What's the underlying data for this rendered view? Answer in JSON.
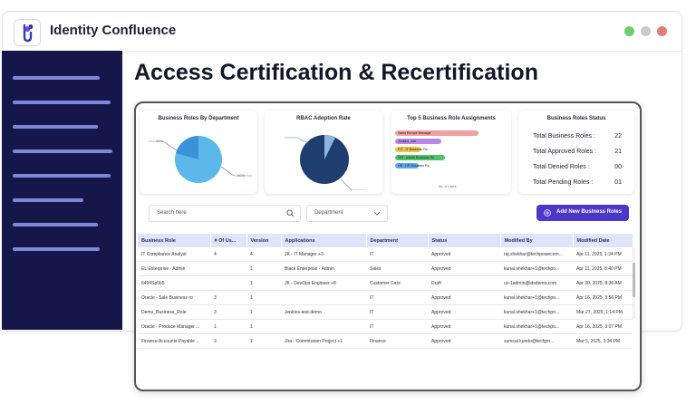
{
  "app": {
    "title": "Identity Confluence"
  },
  "page": {
    "title": "Access Certification & Recertification"
  },
  "colors": {
    "sidebar": "#15174a",
    "accent": "#4b37c9",
    "approved": "#2e9e45",
    "dot_green": "#6ccf6c",
    "dot_gray": "#c9c9cf",
    "dot_red": "#e27b7b"
  },
  "cards": {
    "roles_by_department": {
      "title": "Business Roles By Department",
      "label_left": "10%",
      "label_right": "90%"
    },
    "rbac_adoption": {
      "title": "RBAC Adoption Rate"
    },
    "top5": {
      "title": "Top 5 Business Role Assignments",
      "bars": [
        {
          "label": "Sales Europe Manager",
          "value": 100,
          "color": "#f0a0a0"
        },
        {
          "label": "Jenkins_role",
          "value": 55,
          "color": "#b987e8"
        },
        {
          "label": "FIT - IT Business Ro",
          "value": 30,
          "color": "#f3c24a"
        },
        {
          "label": "FIN - Admin Business Ro",
          "value": 60,
          "color": "#4fc26a"
        },
        {
          "label": "HR - HR Business Ro",
          "value": 28,
          "color": "#5da7ef"
        }
      ],
      "axis_label": "No. of Users"
    },
    "status": {
      "title": "Business Roles Status",
      "rows": [
        {
          "label": "Total Business Roles :",
          "value": "22"
        },
        {
          "label": "Total Approved Roles :",
          "value": "21"
        },
        {
          "label": "Total Denied Roles :",
          "value": "00"
        },
        {
          "label": "Total Pending Roles :",
          "value": "01"
        }
      ]
    }
  },
  "toolbar": {
    "search_placeholder": "Search here",
    "department_select": "Department",
    "add_button": "Add New Business Roles"
  },
  "table": {
    "headers": [
      "Business Role",
      "# Of Us...",
      "Version",
      "Applications",
      "Department",
      "Status",
      "Modified By",
      "Modified Date"
    ],
    "rows": [
      [
        "IT Compliance Analyst",
        "4",
        "4",
        "JK - IT Manager +3",
        "IT",
        "Approved",
        "raj.shekhar@techpowecom...",
        "Apr 11, 2025, 1:34 PM"
      ],
      [
        "EL Enterprise - Admin",
        "",
        "1",
        "Black Enterprise - Admin",
        "Sales",
        "Approved",
        "kunal.shekhar+1@techpo...",
        "Apr 11, 2025, 8:40 PM"
      ],
      [
        "6494Sp5b5",
        "",
        "1",
        "JK - DevOps Engineer +8",
        "Customer Care",
        "Draft",
        "uv-1admin@idsdemo.com",
        "Apr 30, 2025, 8:36 AM"
      ],
      [
        "Oracle - Sale Business ro",
        "3",
        "1",
        "",
        "IT",
        "Approved",
        "kunal.shekhar+1@techpo...",
        "Apr 16, 2025, 3:56 PM"
      ],
      [
        "Demo_Business_Role",
        "3",
        "1",
        "Jenkins-test-demo",
        "IT",
        "Approved",
        "kunal.shekhar+1@techpo...",
        "Mar 27, 2025, 1:14 PM"
      ],
      [
        "Oracle - Produce Manager ...",
        "1",
        "1",
        "",
        "IT",
        "Approved",
        "kunal.shekhar+1@techpo...",
        "Apr 16, 2025, 3:07 PM"
      ],
      [
        "Finance Accounts Payable ...",
        "3",
        "1",
        "Jira - Commission Project +1",
        "Finance",
        "Approved",
        "sumcal.kundo@techpo...",
        "Mar 5, 2025, 3:34 PM"
      ]
    ]
  }
}
